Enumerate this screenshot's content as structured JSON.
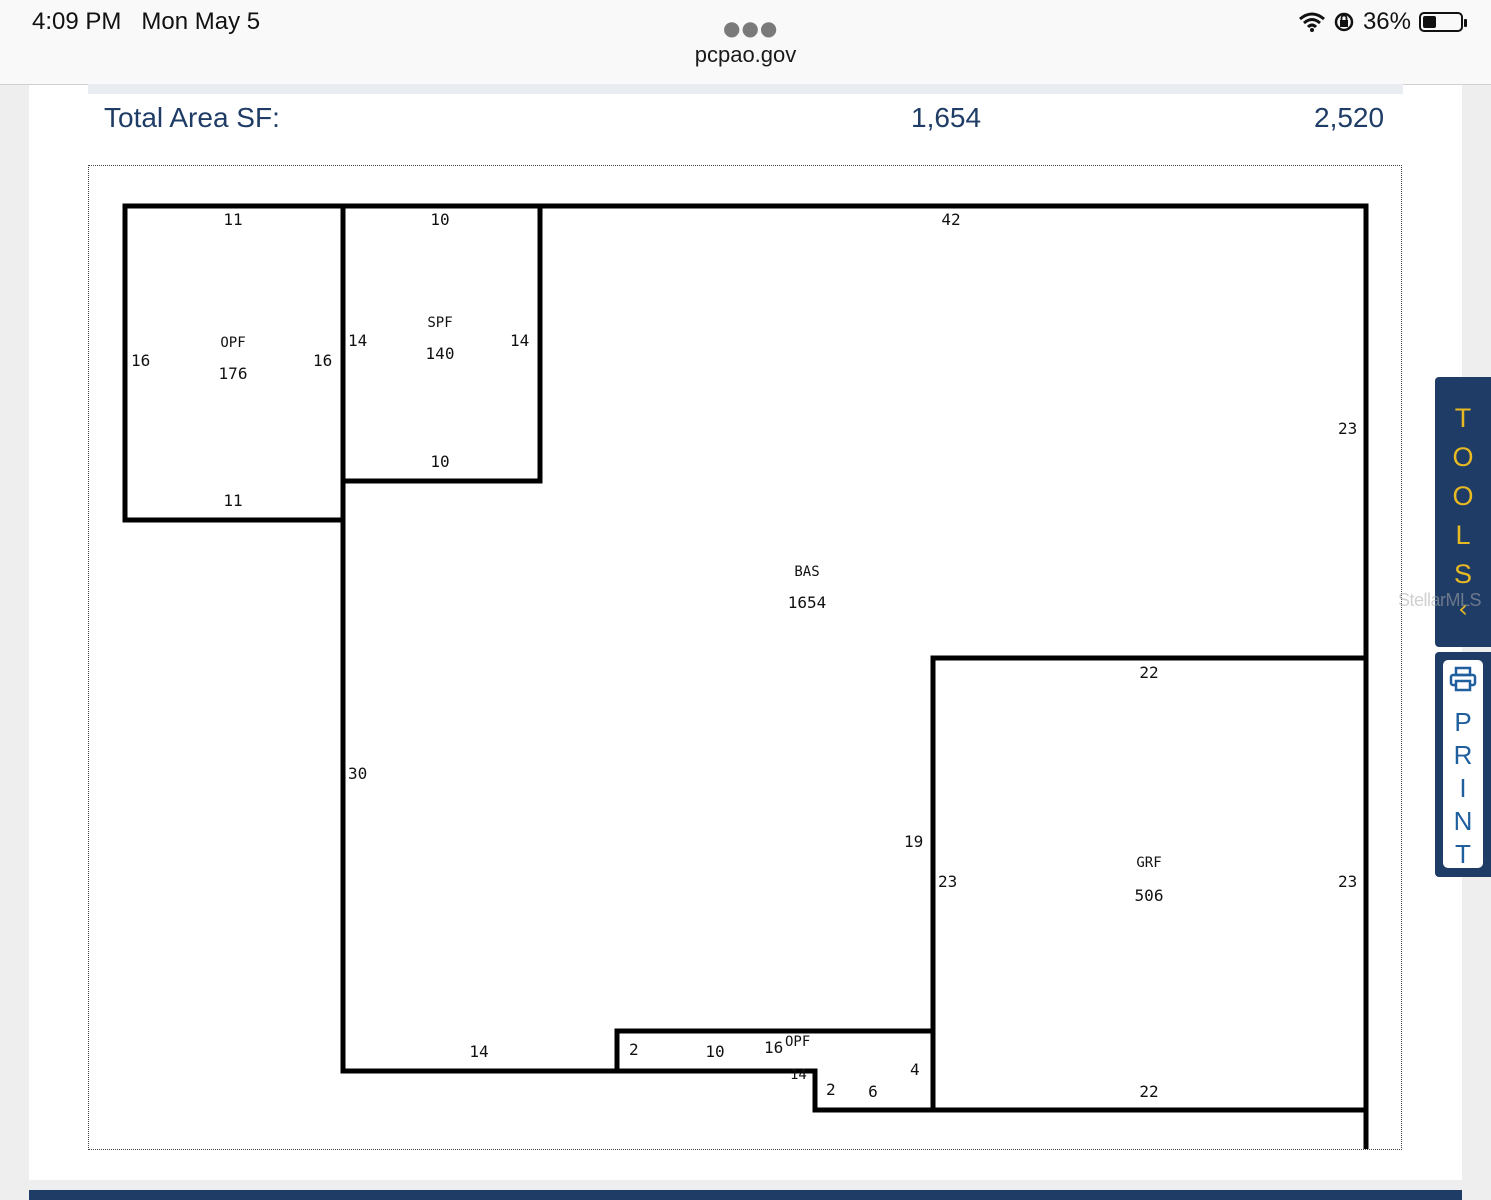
{
  "status": {
    "time": "4:09 PM",
    "date": "Mon May 5",
    "url": "pcpao.gov",
    "battery": "36%",
    "battery_level": 0.36
  },
  "summary": {
    "label": "Total Area SF:",
    "value_1": "1,654",
    "value_2": "2,520"
  },
  "sketch": {
    "opf_top": {
      "name": "OPF",
      "area": "176",
      "top": "11",
      "bottom": "11",
      "left": "16",
      "right": "16"
    },
    "spf": {
      "name": "SPF",
      "area": "140",
      "top": "10",
      "bottom": "10",
      "left": "14",
      "right": "14"
    },
    "bas": {
      "name": "BAS",
      "area": "1654",
      "top": "42",
      "right": "23",
      "left": "30",
      "bottom": "14",
      "inner": "19"
    },
    "grf": {
      "name": "GRF",
      "area": "506",
      "top": "22",
      "bottom": "22",
      "left": "23",
      "right": "23"
    },
    "opf_bottom": {
      "name": "OPF",
      "d_left": "2",
      "d_top": "10",
      "d_right": "16",
      "d_mid": "4",
      "d_step": "2",
      "d_bottom": "6",
      "d_overlap": "14"
    }
  },
  "side_tools": {
    "tools_letters": [
      "T",
      "O",
      "O",
      "L",
      "S"
    ],
    "print_letters": [
      "P",
      "R",
      "I",
      "N",
      "T"
    ]
  },
  "watermark": "StellarMLS",
  "colors": {
    "navy": "#1f3c66",
    "gold": "#e8b923",
    "print_blue": "#1f5f9e"
  }
}
